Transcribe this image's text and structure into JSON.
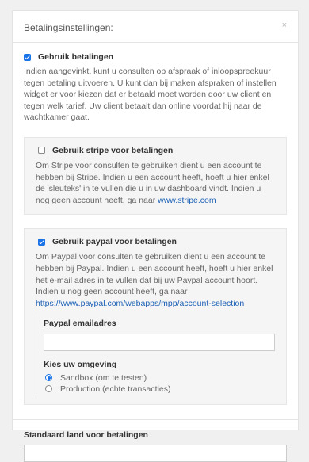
{
  "modal": {
    "title": "Betalingsinstellingen:",
    "close": "×"
  },
  "main_option": {
    "label": "Gebruik betalingen",
    "checked": true,
    "description": "Indien aangevinkt, kunt u consulten op afspraak of inloopspreekuur tegen betaling uitvoeren. U kunt dan bij maken afspraken of instellen widget er voor kiezen dat er betaald moet worden door uw client en tegen welk tarief. Uw client betaalt dan online voordat hij naar de wachtkamer gaat."
  },
  "stripe": {
    "label": "Gebruik stripe voor betalingen",
    "checked": false,
    "description": "Om Stripe voor consulten te gebruiken dient u een account te hebben bij Stripe. Indien u een account heeft, hoeft u hier enkel de 'sleuteks' in te vullen die u in uw dashboard vindt. Indien u nog geen account heeft, ga naar ",
    "link": "www.stripe.com"
  },
  "paypal": {
    "label": "Gebruik paypal voor betalingen",
    "checked": true,
    "description": "Om Paypal voor consulten te gebruiken dient u een account te hebben bij Paypal. Indien u een account heeft, hoeft u hier enkel het e-mail adres in te vullen dat bij uw Paypal account hoort. Indien u nog geen account heeft, ga naar ",
    "link": "https://www.paypal.com/webapps/mpp/account-selection",
    "email_label": "Paypal emailadres",
    "email_value": "",
    "env_label": "Kies uw omgeving",
    "env_options": [
      {
        "label": "Sandbox (om te testen)",
        "selected": true
      },
      {
        "label": "Production (echte transacties)",
        "selected": false
      }
    ]
  },
  "country": {
    "label": "Standaard land voor betalingen"
  },
  "colors": {
    "accent": "#1a73e8",
    "link": "#1a5fb4"
  }
}
